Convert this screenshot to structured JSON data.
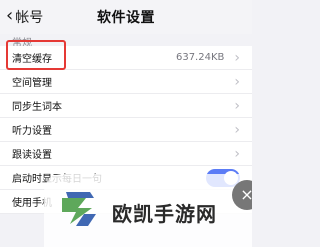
{
  "nav": {
    "back_label": "帐号",
    "title": "软件设置"
  },
  "section": {
    "label": "常规"
  },
  "rows": [
    {
      "label": "清空缓存",
      "value": "637.24KB"
    },
    {
      "label": "空间管理",
      "value": ""
    },
    {
      "label": "同步生词本",
      "value": ""
    },
    {
      "label": "听力设置",
      "value": ""
    },
    {
      "label": "跟读设置",
      "value": ""
    },
    {
      "label": "启动时显示每日一句",
      "value": ""
    },
    {
      "label": "使用手机",
      "value": ""
    }
  ],
  "watermark": {
    "text": "欧凯手游网"
  },
  "colors": {
    "highlight": "#e53935",
    "toggle_on": "#5b7cf6"
  },
  "icons": {
    "back": "chevron-left-icon",
    "arrow": "chevron-right-icon",
    "floating": "close-icon"
  }
}
